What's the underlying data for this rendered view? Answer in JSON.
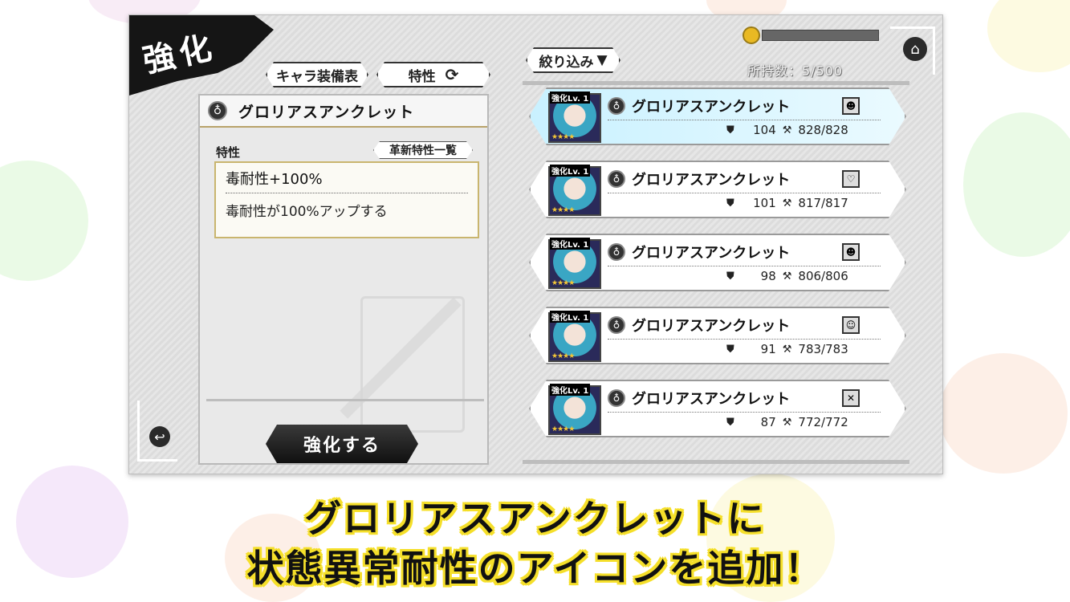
{
  "screen": {
    "title": "強化",
    "tabs": [
      {
        "label": "キャラ装備表"
      },
      {
        "label": "特性"
      }
    ]
  },
  "detail": {
    "item_name": "グロリアスアンクレット",
    "trait_section_label": "特性",
    "trait_list_button": "革新特性一覧",
    "trait_name": "毒耐性+100%",
    "trait_description": "毒耐性が100%アップする",
    "enhance_button": "強化する"
  },
  "list": {
    "filter_label": "絞り込み",
    "count_text": "所持数：5/500",
    "items": [
      {
        "lv": "強化Lv. 1",
        "name": "グロリアスアンクレット",
        "stat1": "104",
        "stat2": "828/828",
        "resist_icon": "resist-mask-icon",
        "selected": true
      },
      {
        "lv": "強化Lv. 1",
        "name": "グロリアスアンクレット",
        "stat1": "101",
        "stat2": "817/817",
        "resist_icon": "resist-heart-icon",
        "selected": false
      },
      {
        "lv": "強化Lv. 1",
        "name": "グロリアスアンクレット",
        "stat1": "98",
        "stat2": "806/806",
        "resist_icon": "resist-mask-icon",
        "selected": false
      },
      {
        "lv": "強化Lv. 1",
        "name": "グロリアスアンクレット",
        "stat1": "91",
        "stat2": "783/783",
        "resist_icon": "resist-face-icon",
        "selected": false
      },
      {
        "lv": "強化Lv. 1",
        "name": "グロリアスアンクレット",
        "stat1": "87",
        "stat2": "772/772",
        "resist_icon": "resist-cross-icon",
        "selected": false
      }
    ]
  },
  "caption": {
    "line1": "グロリアスアンクレットに",
    "line2": "状態異常耐性のアイコンを追加！"
  },
  "colors": {
    "caption_outline": "#f5df2a",
    "selected_card": "#c9f1ff",
    "gold": "#e9b923"
  }
}
